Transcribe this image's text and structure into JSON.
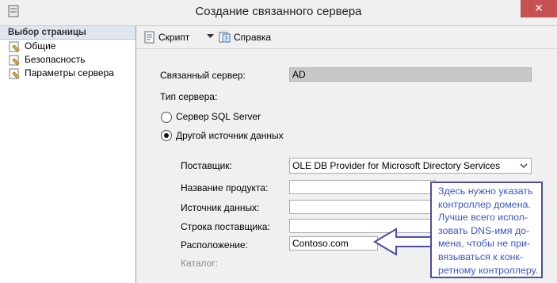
{
  "window": {
    "title": "Создание связанного сервера",
    "close_glyph": "✕"
  },
  "sidebar": {
    "header": "Выбор страницы",
    "items": [
      {
        "label": "Общие",
        "icon": "page-wrench-icon"
      },
      {
        "label": "Безопасность",
        "icon": "page-wrench-icon"
      },
      {
        "label": "Параметры сервера",
        "icon": "page-wrench-icon"
      }
    ]
  },
  "toolbar": {
    "script_label": "Скрипт",
    "help_label": "Справка"
  },
  "form": {
    "linked_server_label": "Связанный сервер:",
    "linked_server_value": "AD",
    "server_type_label": "Тип сервера:",
    "radio_sql_label": "Сервер SQL Server",
    "radio_sql_selected": false,
    "radio_other_label": "Другой источник данных",
    "radio_other_selected": true,
    "provider_label": "Поставщик:",
    "provider_value": "OLE DB Provider for Microsoft Directory Services",
    "product_name_label": "Название продукта:",
    "product_name_value": "",
    "data_source_label": "Источник данных:",
    "data_source_value": "",
    "provider_string_label": "Строка поставщика:",
    "provider_string_value": "",
    "location_label": "Расположение:",
    "location_value": "Contoso.com",
    "catalog_label": "Каталог:"
  },
  "annotation": {
    "lines": [
      "Здесь нужно указать",
      "контроллер домена.",
      "Лучше всего испол-",
      "зовать DNS-имя до-",
      "мена, чтобы не при-",
      "вязываться к конк-",
      "ретному контроллеру."
    ],
    "color": "#3a55c8",
    "arrow_color": "#4a4fa0"
  }
}
